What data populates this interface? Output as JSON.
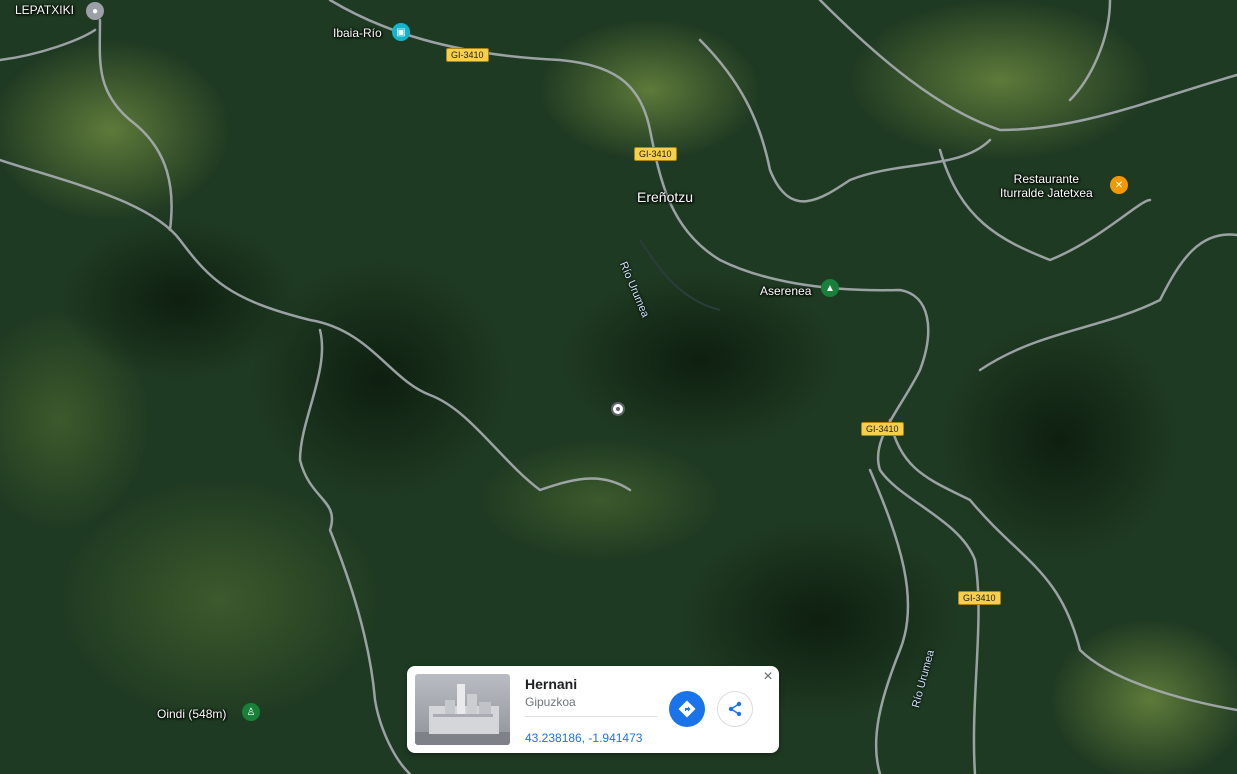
{
  "places": {
    "lepatxiki": "LEPATXIKI",
    "ibaia_rio": "Ibaia-Río",
    "erenotzu": "Ereñotzu",
    "aserenea": "Aserenea",
    "restaurant_line1": "Restaurante",
    "restaurant_line2": "Iturralde Jatetxea",
    "oindi": "Oindi (548m)"
  },
  "roads": {
    "shield_1": "GI-3410",
    "shield_2": "GI-3410",
    "shield_3": "GI-3410",
    "shield_4": "GI-3410"
  },
  "rivers": {
    "river_1": "Río Urumea",
    "river_2": "Río Urumea"
  },
  "icons": {
    "camera": "camera-icon",
    "tree": "tree-icon",
    "restaurant": "fork-knife-icon",
    "hiker": "hiker-icon",
    "pin": "location-pin-icon",
    "directions": "directions-icon",
    "share": "share-icon",
    "close": "close-icon"
  },
  "card": {
    "title": "Hernani",
    "subtitle": "Gipuzkoa",
    "coords": "43.238186, -1.941473",
    "close_label": "×"
  },
  "colors": {
    "accent": "#1a73e8",
    "shield": "#f6d04d",
    "restaurant_pin": "#f29900",
    "park_pin": "#188038"
  }
}
